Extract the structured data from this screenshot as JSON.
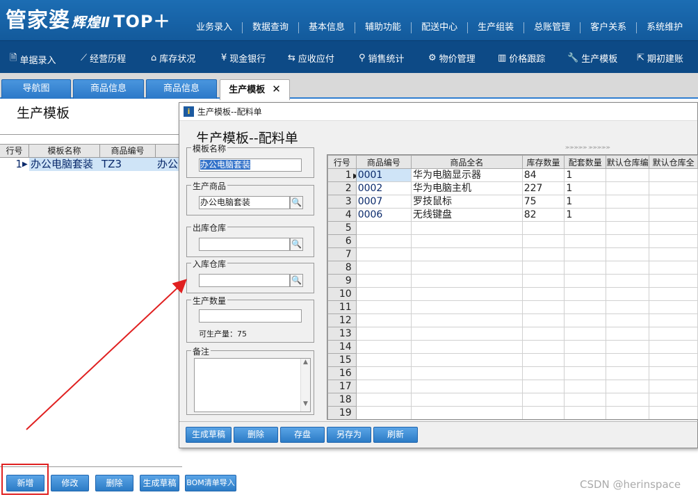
{
  "app": {
    "logo_main": "管家婆",
    "logo_sub": "辉煌Ⅱ",
    "logo_top": "TOP＋"
  },
  "top_menu": [
    "业务录入",
    "数据查询",
    "基本信息",
    "辅助功能",
    "配送中心",
    "生产组装",
    "总账管理",
    "客户关系",
    "系统维护"
  ],
  "nav": [
    {
      "icon": "document-icon",
      "label": "单据录入"
    },
    {
      "icon": "chart-line-icon",
      "label": "经营历程"
    },
    {
      "icon": "home-icon",
      "label": "库存状况"
    },
    {
      "icon": "yen-icon",
      "label": "现金银行"
    },
    {
      "icon": "arrows-icon",
      "label": "应收应付"
    },
    {
      "icon": "search-icon",
      "label": "销售统计"
    },
    {
      "icon": "gear-icon",
      "label": "物价管理"
    },
    {
      "icon": "bar-chart-icon",
      "label": "价格跟踪"
    },
    {
      "icon": "wrench-icon",
      "label": "生产模板"
    },
    {
      "icon": "export-icon",
      "label": "期初建账"
    }
  ],
  "tabs": [
    {
      "label": "导航图",
      "active": false
    },
    {
      "label": "商品信息",
      "active": false
    },
    {
      "label": "商品信息",
      "active": false
    },
    {
      "label": "生产模板",
      "active": true,
      "close": "✕"
    }
  ],
  "page": {
    "title": "生产模板",
    "grid_headers": [
      "行号",
      "模板名称",
      "商品编号",
      ""
    ],
    "rows": [
      {
        "no": "1",
        "name": "办公电脑套装",
        "code": "TZ3",
        "extra": "办公"
      }
    ],
    "buttons": [
      "新增",
      "修改",
      "删除",
      "生成草稿",
      "BOM清单导入"
    ]
  },
  "dialog": {
    "window_title": "生产模板--配料单",
    "heading": "生产模板--配料单",
    "template_name_label": "模板名称",
    "template_name_value": "办公电脑套装",
    "product_label": "生产商品",
    "product_value": "办公电脑套装",
    "out_warehouse_label": "出库仓库",
    "out_warehouse_value": "",
    "in_warehouse_label": "入库仓库",
    "in_warehouse_value": "",
    "qty_label": "生产数量",
    "qty_value": "",
    "producible_label": "可生产量：",
    "producible_value": "75",
    "memo_label": "备注",
    "grid_headers": [
      "行号",
      "商品编号",
      "商品全名",
      "库存数量",
      "配套数量",
      "默认仓库编",
      "默认仓库全"
    ],
    "items": [
      {
        "no": "1",
        "code": "0001",
        "name": "华为电脑显示器",
        "stock": "84",
        "qty": "1"
      },
      {
        "no": "2",
        "code": "0002",
        "name": "华为电脑主机",
        "stock": "227",
        "qty": "1"
      },
      {
        "no": "3",
        "code": "0007",
        "name": "罗技鼠标",
        "stock": "75",
        "qty": "1"
      },
      {
        "no": "4",
        "code": "0006",
        "name": "无线键盘",
        "stock": "82",
        "qty": "1"
      },
      {
        "no": "5",
        "code": "",
        "name": "",
        "stock": "",
        "qty": ""
      },
      {
        "no": "6",
        "code": "",
        "name": "",
        "stock": "",
        "qty": ""
      },
      {
        "no": "7",
        "code": "",
        "name": "",
        "stock": "",
        "qty": ""
      },
      {
        "no": "8",
        "code": "",
        "name": "",
        "stock": "",
        "qty": ""
      },
      {
        "no": "9",
        "code": "",
        "name": "",
        "stock": "",
        "qty": ""
      },
      {
        "no": "10",
        "code": "",
        "name": "",
        "stock": "",
        "qty": ""
      },
      {
        "no": "11",
        "code": "",
        "name": "",
        "stock": "",
        "qty": ""
      },
      {
        "no": "12",
        "code": "",
        "name": "",
        "stock": "",
        "qty": ""
      },
      {
        "no": "13",
        "code": "",
        "name": "",
        "stock": "",
        "qty": ""
      },
      {
        "no": "14",
        "code": "",
        "name": "",
        "stock": "",
        "qty": ""
      },
      {
        "no": "15",
        "code": "",
        "name": "",
        "stock": "",
        "qty": ""
      },
      {
        "no": "16",
        "code": "",
        "name": "",
        "stock": "",
        "qty": ""
      },
      {
        "no": "17",
        "code": "",
        "name": "",
        "stock": "",
        "qty": ""
      },
      {
        "no": "18",
        "code": "",
        "name": "",
        "stock": "",
        "qty": ""
      },
      {
        "no": "19",
        "code": "",
        "name": "",
        "stock": "",
        "qty": ""
      }
    ],
    "buttons": [
      "生成草稿",
      "删除",
      "存盘",
      "另存为",
      "刷新"
    ]
  },
  "watermark": "CSDN @herinspace",
  "colors": {
    "header_blue": "#1c6db3",
    "nav_blue": "#0d4a86",
    "button_blue": "#2c7cc6",
    "annotation_red": "#e02020",
    "selection_blue": "#3372c9"
  }
}
